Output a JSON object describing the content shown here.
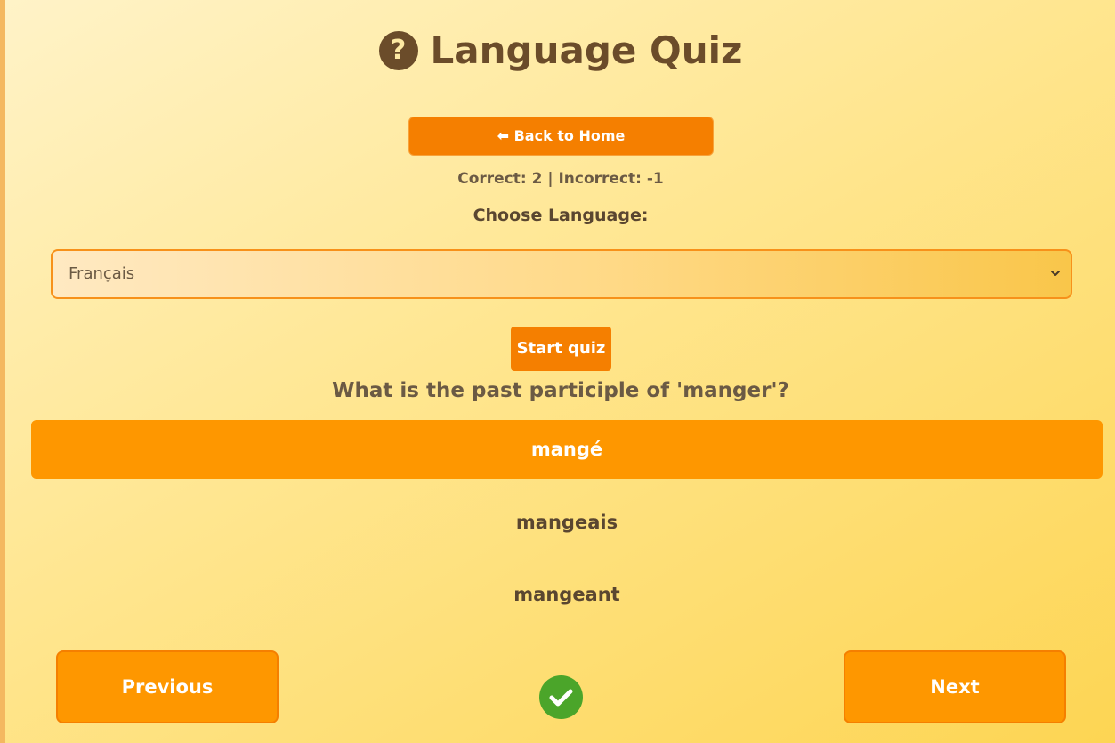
{
  "header": {
    "title": "Language Quiz",
    "icon": "help-circle-icon",
    "icon_glyph": "?"
  },
  "nav": {
    "back_label": "⬅ Back to Home"
  },
  "score": {
    "text": "Correct: 2 | Incorrect: -1",
    "correct": 2,
    "incorrect": -1
  },
  "language": {
    "label": "Choose Language:",
    "selected": "Français"
  },
  "quiz": {
    "start_label": "Start quiz",
    "question": "What is the past participle of 'manger'?",
    "options": [
      {
        "label": "mangé",
        "selected": true
      },
      {
        "label": "mangeais",
        "selected": false
      },
      {
        "label": "mangeant",
        "selected": false
      }
    ],
    "previous_label": "Previous",
    "next_label": "Next",
    "result_icon": "check-circle-icon"
  },
  "colors": {
    "accent": "#f57f00",
    "option_selected": "#fe9700",
    "text_brown": "#6b4c2a",
    "success": "#4ba52a"
  }
}
